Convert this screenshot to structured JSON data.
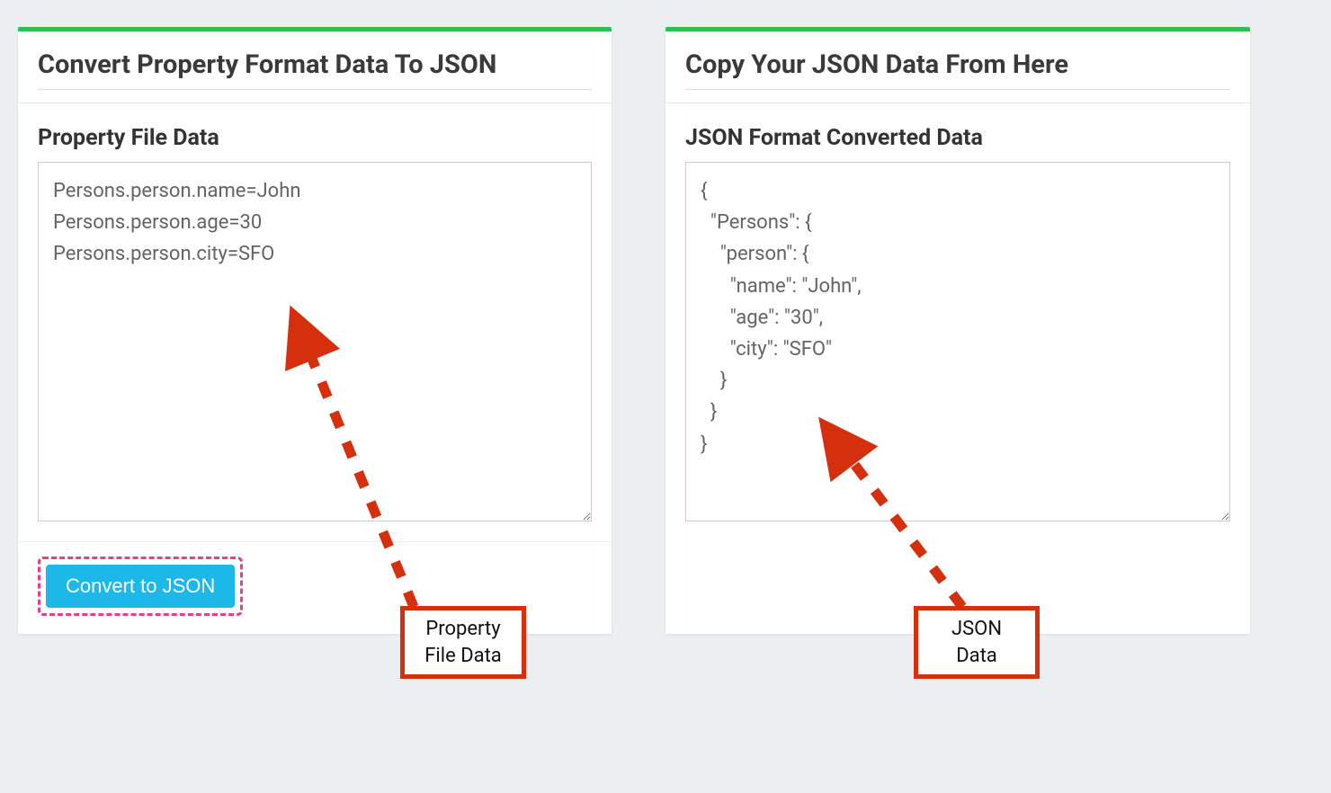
{
  "left_panel": {
    "title": "Convert Property Format Data To JSON",
    "section_label": "Property File Data",
    "textarea_value": "Persons.person.name=John\nPersons.person.age=30\nPersons.person.city=SFO",
    "button_label": "Convert to JSON"
  },
  "right_panel": {
    "title": "Copy Your JSON Data From Here",
    "section_label": "JSON Format Converted Data",
    "textarea_value": "{\n  \"Persons\": {\n    \"person\": {\n      \"name\": \"John\",\n      \"age\": \"30\",\n      \"city\": \"SFO\"\n    }\n  }\n}"
  },
  "annotations": {
    "left_label": "Property\nFile Data",
    "right_label": "JSON\nData"
  },
  "colors": {
    "accent_green": "#2dbf4f",
    "button_blue": "#1cb9e8",
    "annotation_red": "#d62f0e",
    "highlight_pink": "#e83e8c"
  }
}
